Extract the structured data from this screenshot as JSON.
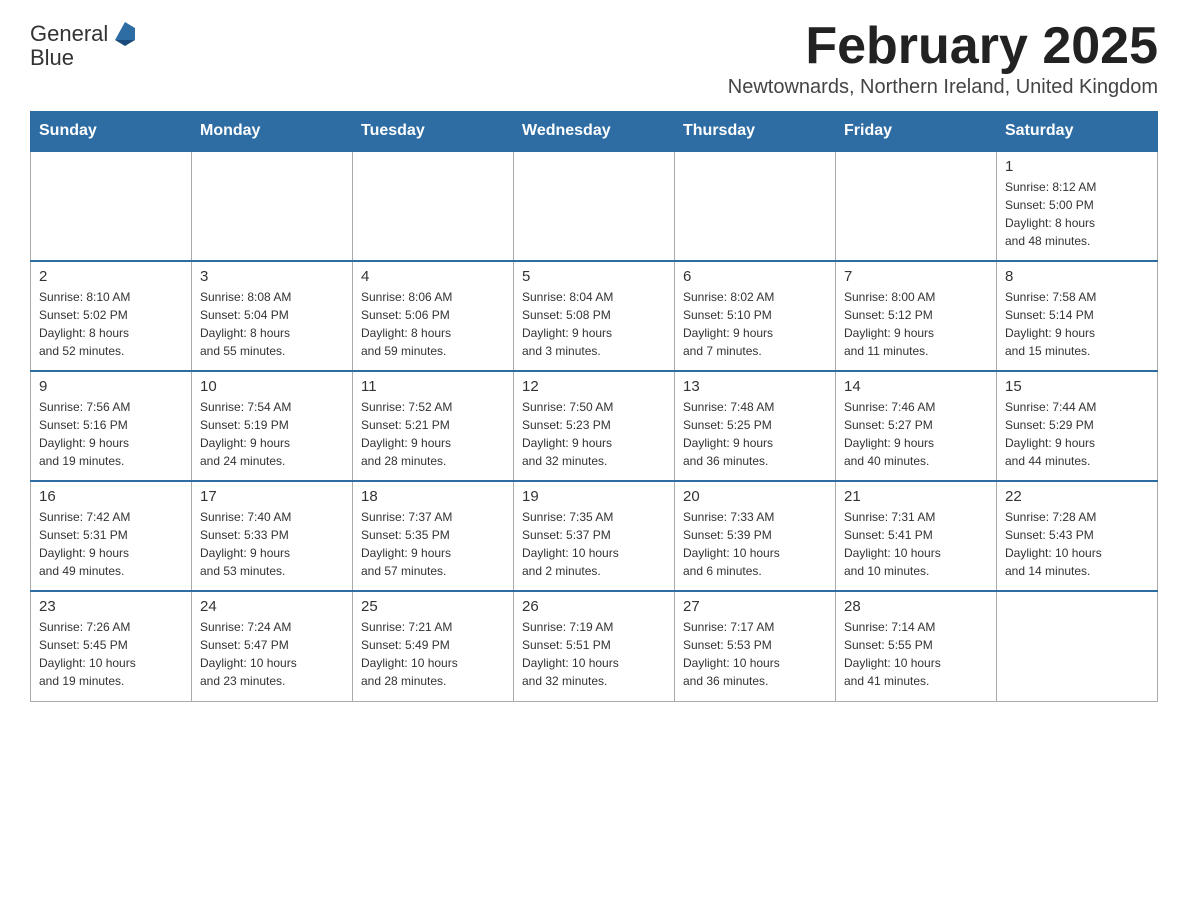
{
  "header": {
    "logo_general": "General",
    "logo_blue": "Blue",
    "month_title": "February 2025",
    "location": "Newtownards, Northern Ireland, United Kingdom"
  },
  "days_of_week": [
    "Sunday",
    "Monday",
    "Tuesday",
    "Wednesday",
    "Thursday",
    "Friday",
    "Saturday"
  ],
  "weeks": [
    [
      {
        "num": "",
        "info": ""
      },
      {
        "num": "",
        "info": ""
      },
      {
        "num": "",
        "info": ""
      },
      {
        "num": "",
        "info": ""
      },
      {
        "num": "",
        "info": ""
      },
      {
        "num": "",
        "info": ""
      },
      {
        "num": "1",
        "info": "Sunrise: 8:12 AM\nSunset: 5:00 PM\nDaylight: 8 hours\nand 48 minutes."
      }
    ],
    [
      {
        "num": "2",
        "info": "Sunrise: 8:10 AM\nSunset: 5:02 PM\nDaylight: 8 hours\nand 52 minutes."
      },
      {
        "num": "3",
        "info": "Sunrise: 8:08 AM\nSunset: 5:04 PM\nDaylight: 8 hours\nand 55 minutes."
      },
      {
        "num": "4",
        "info": "Sunrise: 8:06 AM\nSunset: 5:06 PM\nDaylight: 8 hours\nand 59 minutes."
      },
      {
        "num": "5",
        "info": "Sunrise: 8:04 AM\nSunset: 5:08 PM\nDaylight: 9 hours\nand 3 minutes."
      },
      {
        "num": "6",
        "info": "Sunrise: 8:02 AM\nSunset: 5:10 PM\nDaylight: 9 hours\nand 7 minutes."
      },
      {
        "num": "7",
        "info": "Sunrise: 8:00 AM\nSunset: 5:12 PM\nDaylight: 9 hours\nand 11 minutes."
      },
      {
        "num": "8",
        "info": "Sunrise: 7:58 AM\nSunset: 5:14 PM\nDaylight: 9 hours\nand 15 minutes."
      }
    ],
    [
      {
        "num": "9",
        "info": "Sunrise: 7:56 AM\nSunset: 5:16 PM\nDaylight: 9 hours\nand 19 minutes."
      },
      {
        "num": "10",
        "info": "Sunrise: 7:54 AM\nSunset: 5:19 PM\nDaylight: 9 hours\nand 24 minutes."
      },
      {
        "num": "11",
        "info": "Sunrise: 7:52 AM\nSunset: 5:21 PM\nDaylight: 9 hours\nand 28 minutes."
      },
      {
        "num": "12",
        "info": "Sunrise: 7:50 AM\nSunset: 5:23 PM\nDaylight: 9 hours\nand 32 minutes."
      },
      {
        "num": "13",
        "info": "Sunrise: 7:48 AM\nSunset: 5:25 PM\nDaylight: 9 hours\nand 36 minutes."
      },
      {
        "num": "14",
        "info": "Sunrise: 7:46 AM\nSunset: 5:27 PM\nDaylight: 9 hours\nand 40 minutes."
      },
      {
        "num": "15",
        "info": "Sunrise: 7:44 AM\nSunset: 5:29 PM\nDaylight: 9 hours\nand 44 minutes."
      }
    ],
    [
      {
        "num": "16",
        "info": "Sunrise: 7:42 AM\nSunset: 5:31 PM\nDaylight: 9 hours\nand 49 minutes."
      },
      {
        "num": "17",
        "info": "Sunrise: 7:40 AM\nSunset: 5:33 PM\nDaylight: 9 hours\nand 53 minutes."
      },
      {
        "num": "18",
        "info": "Sunrise: 7:37 AM\nSunset: 5:35 PM\nDaylight: 9 hours\nand 57 minutes."
      },
      {
        "num": "19",
        "info": "Sunrise: 7:35 AM\nSunset: 5:37 PM\nDaylight: 10 hours\nand 2 minutes."
      },
      {
        "num": "20",
        "info": "Sunrise: 7:33 AM\nSunset: 5:39 PM\nDaylight: 10 hours\nand 6 minutes."
      },
      {
        "num": "21",
        "info": "Sunrise: 7:31 AM\nSunset: 5:41 PM\nDaylight: 10 hours\nand 10 minutes."
      },
      {
        "num": "22",
        "info": "Sunrise: 7:28 AM\nSunset: 5:43 PM\nDaylight: 10 hours\nand 14 minutes."
      }
    ],
    [
      {
        "num": "23",
        "info": "Sunrise: 7:26 AM\nSunset: 5:45 PM\nDaylight: 10 hours\nand 19 minutes."
      },
      {
        "num": "24",
        "info": "Sunrise: 7:24 AM\nSunset: 5:47 PM\nDaylight: 10 hours\nand 23 minutes."
      },
      {
        "num": "25",
        "info": "Sunrise: 7:21 AM\nSunset: 5:49 PM\nDaylight: 10 hours\nand 28 minutes."
      },
      {
        "num": "26",
        "info": "Sunrise: 7:19 AM\nSunset: 5:51 PM\nDaylight: 10 hours\nand 32 minutes."
      },
      {
        "num": "27",
        "info": "Sunrise: 7:17 AM\nSunset: 5:53 PM\nDaylight: 10 hours\nand 36 minutes."
      },
      {
        "num": "28",
        "info": "Sunrise: 7:14 AM\nSunset: 5:55 PM\nDaylight: 10 hours\nand 41 minutes."
      },
      {
        "num": "",
        "info": ""
      }
    ]
  ]
}
